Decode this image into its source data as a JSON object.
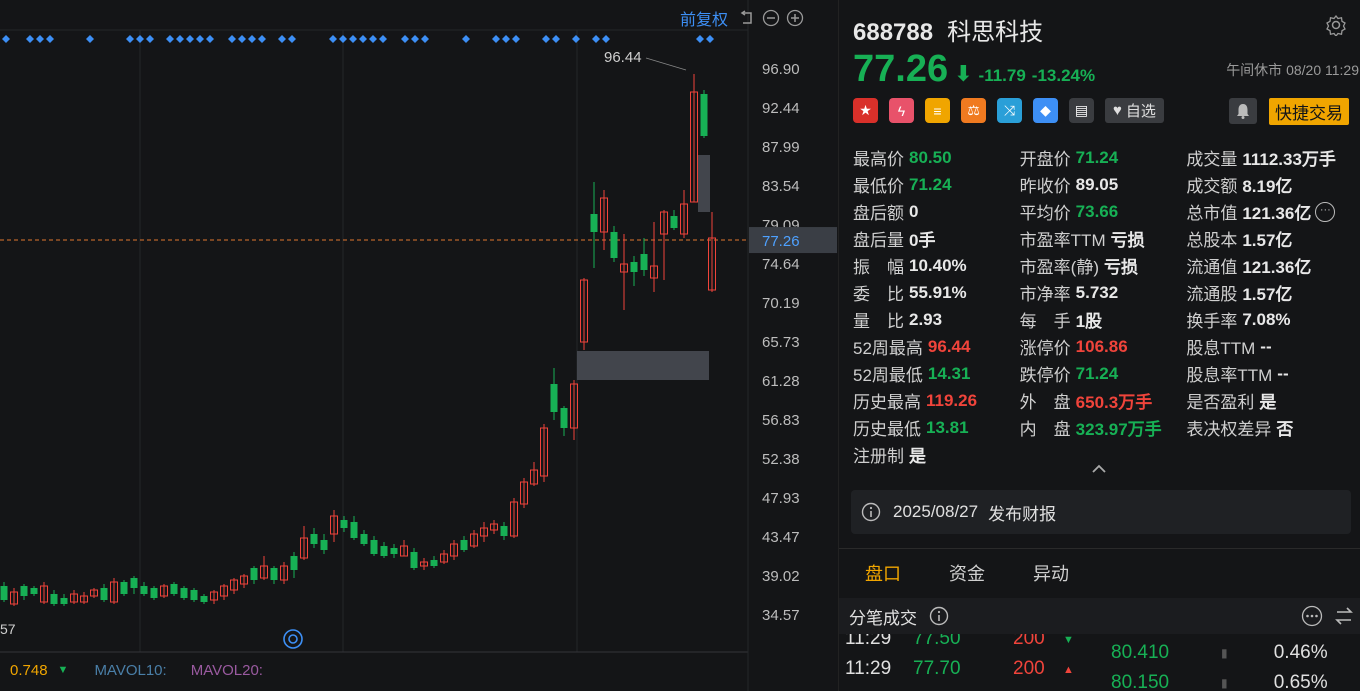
{
  "chart": {
    "fuquan_label": "前复权",
    "price_axis": [
      "96.90",
      "92.44",
      "87.99",
      "83.54",
      "79.09",
      "77.26",
      "74.64",
      "70.19",
      "65.73",
      "61.28",
      "56.83",
      "52.38",
      "47.93",
      "43.47",
      "39.02",
      "34.57"
    ],
    "peak_label": "96.44",
    "left_partial_label": "57",
    "volume_legend": {
      "value": "0.748",
      "mavol10": "MAVOL10:",
      "mavol20": "MAVOL20:"
    },
    "colors": {
      "up": "#f0443b",
      "down": "#17b055",
      "dash": "#e0782f",
      "marker": "#3d8ff5"
    }
  },
  "stock": {
    "code": "688788",
    "name": "科思科技",
    "price": "77.26",
    "change": "-11.79",
    "change_pct": "-13.24%",
    "status": "午间休市 08/20 11:29",
    "watchlist_label": "自选",
    "trade_button": "快捷交易"
  },
  "quote": [
    [
      {
        "label": "最高价",
        "value": "80.50",
        "color": "g"
      },
      {
        "label": "开盘价",
        "value": "71.24",
        "color": "g"
      },
      {
        "label": "成交量",
        "value": "1112.33万手",
        "color": "w"
      }
    ],
    [
      {
        "label": "最低价",
        "value": "71.24",
        "color": "g"
      },
      {
        "label": "昨收价",
        "value": "89.05",
        "color": "w"
      },
      {
        "label": "成交额",
        "value": "8.19亿",
        "color": "w"
      }
    ],
    [
      {
        "label": "盘后额",
        "value": "0",
        "color": "w"
      },
      {
        "label": "平均价",
        "value": "73.66",
        "color": "g"
      },
      {
        "label": "总市值",
        "value": "121.36亿",
        "color": "w"
      }
    ],
    [
      {
        "label": "盘后量",
        "value": "0手",
        "color": "w"
      },
      {
        "label": "市盈率TTM",
        "value": "亏损",
        "color": "w"
      },
      {
        "label": "总股本",
        "value": "1.57亿",
        "color": "w"
      }
    ],
    [
      {
        "label": "振　幅",
        "value": "10.40%",
        "color": "w"
      },
      {
        "label": "市盈率(静)",
        "value": "亏损",
        "color": "w"
      },
      {
        "label": "流通值",
        "value": "121.36亿",
        "color": "w"
      }
    ],
    [
      {
        "label": "委　比",
        "value": "55.91%",
        "color": "w"
      },
      {
        "label": "市净率",
        "value": "5.732",
        "color": "w"
      },
      {
        "label": "流通股",
        "value": "1.57亿",
        "color": "w"
      }
    ],
    [
      {
        "label": "量　比",
        "value": "2.93",
        "color": "w"
      },
      {
        "label": "每　手",
        "value": "1股",
        "color": "w"
      },
      {
        "label": "换手率",
        "value": "7.08%",
        "color": "w"
      }
    ],
    [
      {
        "label": "52周最高",
        "value": "96.44",
        "color": "r"
      },
      {
        "label": "涨停价",
        "value": "106.86",
        "color": "r"
      },
      {
        "label": "股息TTM",
        "value": "--",
        "color": "w"
      }
    ],
    [
      {
        "label": "52周最低",
        "value": "14.31",
        "color": "g"
      },
      {
        "label": "跌停价",
        "value": "71.24",
        "color": "g"
      },
      {
        "label": "股息率TTM",
        "value": "--",
        "color": "w"
      }
    ],
    [
      {
        "label": "历史最高",
        "value": "119.26",
        "color": "r"
      },
      {
        "label": "外　盘",
        "value": "650.3万手",
        "color": "r"
      },
      {
        "label": "是否盈利",
        "value": "是",
        "color": "w"
      }
    ],
    [
      {
        "label": "历史最低",
        "value": "13.81",
        "color": "g"
      },
      {
        "label": "内　盘",
        "value": "323.97万手",
        "color": "g"
      },
      {
        "label": "表决权差异",
        "value": "否",
        "color": "w"
      }
    ],
    [
      {
        "label": "注册制",
        "value": "是",
        "color": "w"
      }
    ]
  ],
  "notice": {
    "date": "2025/08/27",
    "text": "发布财报"
  },
  "tabs": [
    "盘口",
    "资金",
    "异动"
  ],
  "ticks_section": {
    "title": "分笔成交"
  },
  "ticks": [
    {
      "time": "11:29",
      "price": "77.50",
      "vol": "200",
      "dir": "down"
    },
    {
      "time": "11:29",
      "price": "77.70",
      "vol": "200",
      "dir": "up"
    }
  ],
  "levels": [
    {
      "price": "80.410",
      "pct": "0.46%"
    },
    {
      "price": "80.150",
      "pct": "0.65%"
    }
  ]
}
